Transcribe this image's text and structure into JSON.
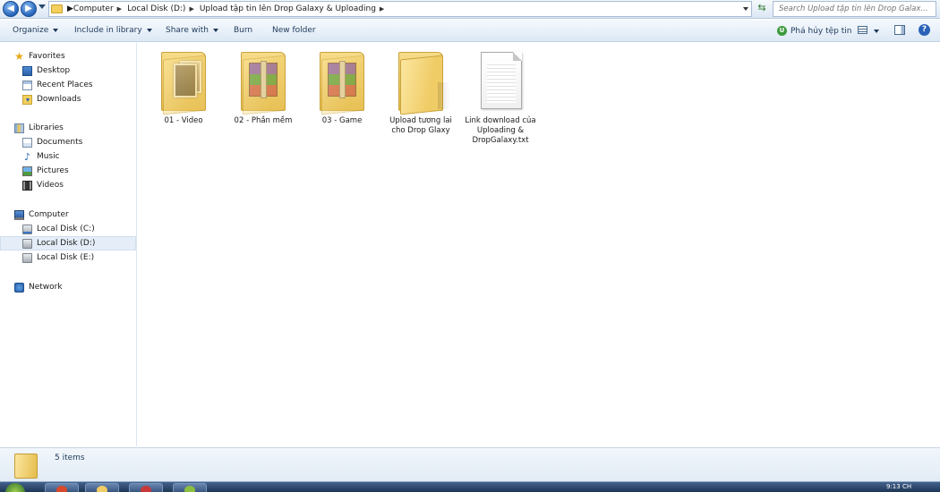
{
  "address": {
    "crumbs": [
      "Computer",
      "Local Disk (D:)",
      "Upload tập tin lên Drop Galaxy & Uploading"
    ],
    "search_placeholder": "Search Upload tập tin lên Drop Galax..."
  },
  "toolbar": {
    "organize": "Organize",
    "include_in_library": "Include in library",
    "share_with": "Share with",
    "burn": "Burn",
    "new_folder": "New folder",
    "shred": "Phá hủy tệp tin"
  },
  "nav": {
    "favorites": "Favorites",
    "desktop": "Desktop",
    "recent_places": "Recent Places",
    "downloads": "Downloads",
    "libraries": "Libraries",
    "documents": "Documents",
    "music": "Music",
    "pictures": "Pictures",
    "videos": "Videos",
    "computer": "Computer",
    "disk_c": "Local Disk (C:)",
    "disk_d": "Local Disk (D:)",
    "disk_e": "Local Disk (E:)",
    "network": "Network"
  },
  "files": [
    {
      "name": "01 - Video",
      "type": "folder-photos"
    },
    {
      "name": "02 - Phần mềm",
      "type": "folder-rar"
    },
    {
      "name": "03 - Game",
      "type": "folder-rar"
    },
    {
      "name": "Upload tương lai cho Drop Glaxy",
      "type": "folder-empty"
    },
    {
      "name": "Link download của Uploading & DropGalaxy.txt",
      "type": "text-file"
    }
  ],
  "details": {
    "count": "5 items"
  },
  "taskbar": {
    "clock": "9:13 CH"
  },
  "colors": {
    "accent": "#2a62b6",
    "folder": "#f0cc66",
    "chrome_bg": "#dde8f5"
  }
}
